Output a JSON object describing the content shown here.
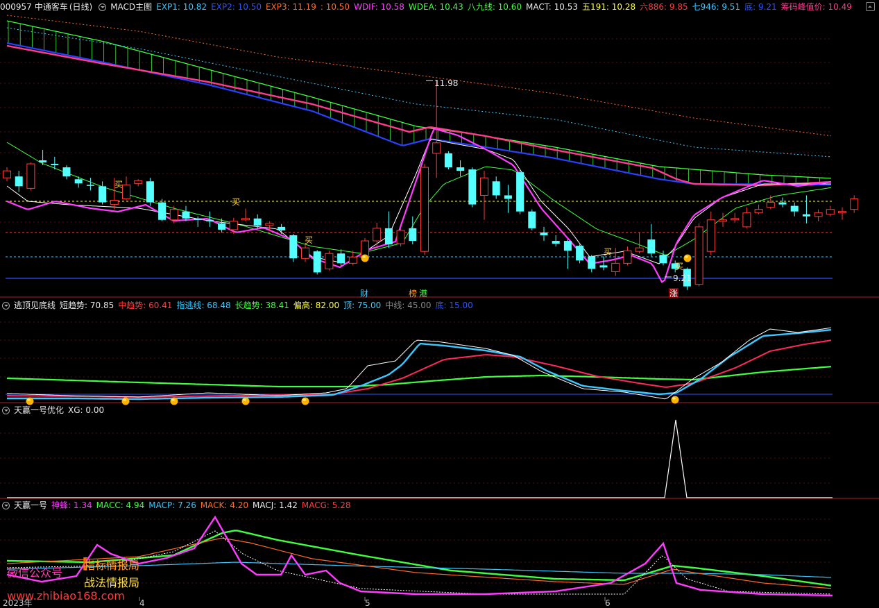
{
  "header": {
    "code": "000957",
    "name": "中通客车",
    "period": "(日线)",
    "indicator": "MACD主图",
    "items": [
      {
        "label": "EXP1: 10.82",
        "color": "#3cc8ff"
      },
      {
        "label": "EXP2: 10.50",
        "color": "#2a55ff"
      },
      {
        "label": "EXP3: 11.19",
        "color": "#ff6a2a"
      },
      {
        "label": ": 10.50",
        "color": "#ff6a2a"
      },
      {
        "label": "WDIF: 10.58",
        "color": "#ff3cff"
      },
      {
        "label": "WDEA: 10.43",
        "color": "#40ff40"
      },
      {
        "label": "八九线: 10.60",
        "color": "#40ff40"
      },
      {
        "label": "MACT: 10.53",
        "color": "#e8e8e8"
      },
      {
        "label": "五191: 10.28",
        "color": "#ffff40"
      },
      {
        "label": "六886: 9.85",
        "color": "#ff3c3c"
      },
      {
        "label": "七946: 9.51",
        "color": "#3cc8ff"
      },
      {
        "label": "底: 9.21",
        "color": "#2a55ff"
      },
      {
        "label": "筹码峰值价: 10.49",
        "color": "#ff3c8c"
      }
    ]
  },
  "price_labels": {
    "high": "11.98",
    "low": "9.21"
  },
  "signals": {
    "buy": "买",
    "cai": "财",
    "bang": "榜",
    "gang": "港",
    "zhang": "涨"
  },
  "panel2": {
    "title": "逃顶见底线",
    "items": [
      {
        "label": "短趋势: 70.85",
        "color": "#e8e8e8"
      },
      {
        "label": "中趋势: 60.41",
        "color": "#ff3c3c"
      },
      {
        "label": "指逃线: 68.48",
        "color": "#3cc8ff"
      },
      {
        "label": "长趋势: 38.41",
        "color": "#40ff40"
      },
      {
        "label": "偏高: 82.00",
        "color": "#ffff40"
      },
      {
        "label": "顶: 75.00",
        "color": "#3cc8ff"
      },
      {
        "label": "中线: 45.00",
        "color": "#888888"
      },
      {
        "label": "底: 15.00",
        "color": "#2a55ff"
      }
    ]
  },
  "panel3": {
    "title": "天赢一号优化",
    "items": [
      {
        "label": "XG: 0.00",
        "color": "#e8e8e8"
      }
    ]
  },
  "panel4": {
    "title": "天赢一号",
    "items": [
      {
        "label": "神蜂: 1.34",
        "color": "#ff3cff"
      },
      {
        "label": "MACC: 4.94",
        "color": "#40ff40"
      },
      {
        "label": "MACP: 7.26",
        "color": "#3cc8ff"
      },
      {
        "label": "MACK: 4.20",
        "color": "#ff6a2a"
      },
      {
        "label": "MACJ: 1.42",
        "color": "#e8e8e8"
      },
      {
        "label": "MACG: 5.28",
        "color": "#ff3c3c"
      }
    ]
  },
  "xaxis": [
    "2023年",
    "4",
    "5",
    "6"
  ],
  "watermark": {
    "wechat": "微信公众号",
    "brand1": "指标情报局",
    "brand2": "战法情报局",
    "url": "www.zhibiao168.com"
  },
  "chart_data": {
    "type": "candlestick",
    "candles": [
      [
        10.6,
        10.7,
        10.75,
        10.55
      ],
      [
        10.62,
        10.48,
        10.7,
        10.4
      ],
      [
        10.45,
        10.8,
        10.82,
        10.42
      ],
      [
        10.85,
        10.82,
        11.0,
        10.78
      ],
      [
        10.8,
        10.78,
        10.9,
        10.72
      ],
      [
        10.75,
        10.62,
        10.78,
        10.58
      ],
      [
        10.58,
        10.52,
        10.62,
        10.46
      ],
      [
        10.5,
        10.49,
        10.6,
        10.42
      ],
      [
        10.48,
        10.25,
        10.55,
        10.22
      ],
      [
        10.22,
        10.28,
        10.6,
        10.15
      ],
      [
        10.3,
        10.5,
        10.62,
        10.28
      ],
      [
        10.52,
        10.56,
        10.58,
        10.48
      ],
      [
        10.55,
        10.25,
        10.6,
        10.2
      ],
      [
        10.25,
        10.0,
        10.3,
        9.98
      ],
      [
        10.0,
        10.15,
        10.2,
        9.95
      ],
      [
        10.12,
        10.02,
        10.2,
        9.98
      ],
      [
        10.02,
        10.0,
        10.05,
        9.9
      ],
      [
        10.0,
        9.98,
        10.12,
        9.9
      ],
      [
        9.95,
        9.86,
        10.02,
        9.82
      ],
      [
        9.86,
        9.98,
        10.03,
        9.8
      ],
      [
        10.0,
        10.02,
        10.16,
        9.98
      ],
      [
        10.02,
        9.92,
        10.08,
        9.88
      ],
      [
        9.92,
        9.95,
        9.98,
        9.85
      ],
      [
        9.9,
        9.85,
        9.94,
        9.8
      ],
      [
        9.78,
        9.45,
        9.8,
        9.4
      ],
      [
        9.45,
        9.6,
        9.65,
        9.4
      ],
      [
        9.55,
        9.25,
        9.57,
        9.22
      ],
      [
        9.3,
        9.52,
        9.56,
        9.28
      ],
      [
        9.52,
        9.38,
        9.58,
        9.34
      ],
      [
        9.38,
        9.47,
        9.56,
        9.35
      ],
      [
        9.46,
        9.7,
        9.74,
        9.44
      ],
      [
        9.7,
        9.88,
        9.96,
        9.6
      ],
      [
        9.88,
        9.65,
        10.12,
        9.6
      ],
      [
        9.66,
        9.85,
        9.88,
        9.62
      ],
      [
        9.88,
        9.7,
        10.05,
        9.65
      ],
      [
        9.55,
        10.75,
        10.8,
        9.5
      ],
      [
        10.95,
        11.1,
        11.98,
        10.6
      ],
      [
        10.95,
        10.75,
        10.98,
        10.72
      ],
      [
        10.75,
        10.7,
        10.85,
        10.62
      ],
      [
        10.72,
        10.22,
        10.75,
        10.18
      ],
      [
        10.35,
        10.6,
        10.7,
        10.0
      ],
      [
        10.55,
        10.35,
        10.62,
        10.3
      ],
      [
        10.35,
        10.3,
        10.5,
        10.1
      ],
      [
        10.68,
        10.12,
        10.72,
        10.08
      ],
      [
        10.12,
        9.88,
        10.15,
        9.85
      ],
      [
        9.82,
        9.78,
        9.9,
        9.7
      ],
      [
        9.7,
        9.66,
        9.78,
        9.62
      ],
      [
        9.7,
        9.56,
        9.72,
        9.3
      ],
      [
        9.63,
        9.42,
        9.65,
        9.38
      ],
      [
        9.48,
        9.3,
        9.5,
        9.25
      ],
      [
        9.35,
        9.32,
        9.48,
        9.28
      ],
      [
        9.26,
        9.38,
        9.6,
        9.2
      ],
      [
        9.38,
        9.56,
        9.62,
        9.35
      ],
      [
        9.55,
        9.6,
        9.82,
        9.52
      ],
      [
        9.72,
        9.52,
        9.94,
        9.48
      ],
      [
        9.5,
        9.38,
        9.56,
        9.35
      ],
      [
        9.38,
        9.3,
        9.42,
        9.25
      ],
      [
        9.3,
        9.05,
        9.32,
        9.0
      ],
      [
        9.08,
        9.9,
        9.95,
        9.05
      ],
      [
        9.55,
        10.0,
        10.12,
        9.5
      ],
      [
        9.98,
        10.0,
        10.1,
        9.9
      ],
      [
        10.0,
        10.02,
        10.1,
        9.96
      ],
      [
        9.9,
        10.1,
        10.18,
        9.88
      ],
      [
        10.1,
        10.15,
        10.22,
        10.08
      ],
      [
        10.18,
        10.25,
        10.35,
        10.15
      ],
      [
        10.25,
        10.22,
        10.32,
        10.18
      ],
      [
        10.2,
        10.12,
        10.25,
        10.05
      ],
      [
        10.08,
        10.05,
        10.35,
        9.95
      ],
      [
        10.05,
        10.1,
        10.15,
        9.98
      ],
      [
        10.08,
        10.15,
        10.2,
        10.05
      ],
      [
        10.1,
        10.12,
        10.18,
        10.0
      ],
      [
        10.15,
        10.3,
        10.35,
        10.1
      ]
    ]
  }
}
